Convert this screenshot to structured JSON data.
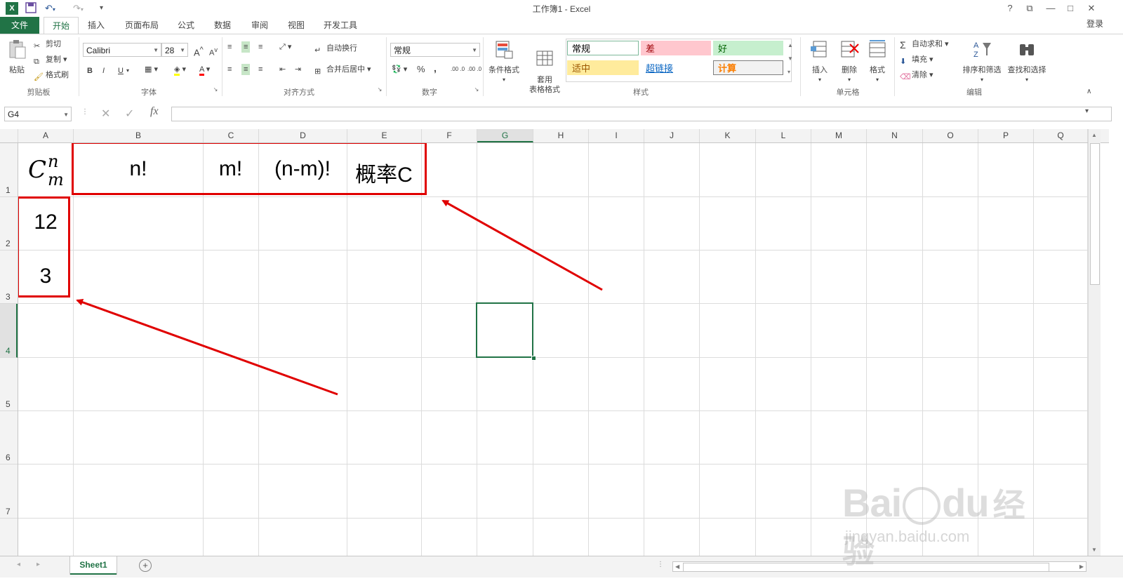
{
  "app": {
    "title": "工作簿1 - Excel",
    "login": "登录",
    "quick_access": {
      "undo_arrow": "▾",
      "redo_arrow": "▾",
      "more": "▾"
    },
    "window_controls": [
      "?",
      "⧉",
      "—",
      "□",
      "✕"
    ]
  },
  "tabs": [
    "文件",
    "开始",
    "插入",
    "页面布局",
    "公式",
    "数据",
    "审阅",
    "视图",
    "开发工具"
  ],
  "active_tab": "开始",
  "ribbon": {
    "clipboard": {
      "label": "剪贴板",
      "paste": "粘贴",
      "cut": "剪切",
      "copy": "复制",
      "format_painter": "格式刷"
    },
    "font": {
      "label": "字体",
      "name": "Calibri",
      "size": "28",
      "bold": "B",
      "italic": "I",
      "underline": "U",
      "font_color_letter": "A",
      "grow": "A",
      "shrink": "A"
    },
    "alignment": {
      "label": "对齐方式",
      "wrap": "自动换行",
      "merge": "合并后居中"
    },
    "number": {
      "label": "数字",
      "format": "常规",
      "percent": "%",
      "comma": ",",
      "inc_decimal": ".00 .0",
      "dec_decimal": ".00 .0"
    },
    "styles": {
      "label": "样式",
      "conditional": "条件格式",
      "table_format": "套用\n表格格式",
      "cells": [
        {
          "text": "常规",
          "bg": "#ffffff",
          "fg": "#000000",
          "border": "#7eb89a"
        },
        {
          "text": "差",
          "bg": "#ffc7ce",
          "fg": "#9c0006",
          "border": "#ffc7ce"
        },
        {
          "text": "好",
          "bg": "#c6efce",
          "fg": "#006100",
          "border": "#c6efce"
        },
        {
          "text": "适中",
          "bg": "#ffeb9c",
          "fg": "#9c5700",
          "border": "#ffeb9c"
        },
        {
          "text": "超链接",
          "bg": "#ffffff",
          "fg": "#0563c1",
          "border": "#ffffff"
        },
        {
          "text": "计算",
          "bg": "#f2f2f2",
          "fg": "#fa7d00",
          "border": "#7f7f7f"
        }
      ]
    },
    "cells_group": {
      "label": "单元格",
      "insert": "插入",
      "delete": "删除",
      "format": "格式"
    },
    "editing": {
      "label": "编辑",
      "autosum": "自动求和",
      "fill": "填充",
      "clear": "清除",
      "sort_filter": "排序和筛选",
      "find_select": "查找和选择"
    }
  },
  "formula_bar": {
    "name_box": "G4",
    "fx": "fx",
    "content": ""
  },
  "columns": [
    "A",
    "B",
    "C",
    "D",
    "E",
    "F",
    "G",
    "H",
    "I",
    "J",
    "K",
    "L",
    "M",
    "N",
    "O",
    "P",
    "Q"
  ],
  "selected_column": "G",
  "rows": [
    "1",
    "2",
    "3",
    "4",
    "5",
    "6",
    "7"
  ],
  "selected_row": "4",
  "cells": {
    "A1_base": "C",
    "A1_sup": "n",
    "A1_sub": "m",
    "B1": "n!",
    "C1": "m!",
    "D1": "(n-m)!",
    "E1": "概率C",
    "A2": "12",
    "A3": "3"
  },
  "sheets": [
    "Sheet1"
  ],
  "watermark": {
    "brand": "Bai",
    "brand2": "du",
    "cn": "经验",
    "url": "jingyan.baidu.com"
  },
  "annotation_color": "#e00000"
}
